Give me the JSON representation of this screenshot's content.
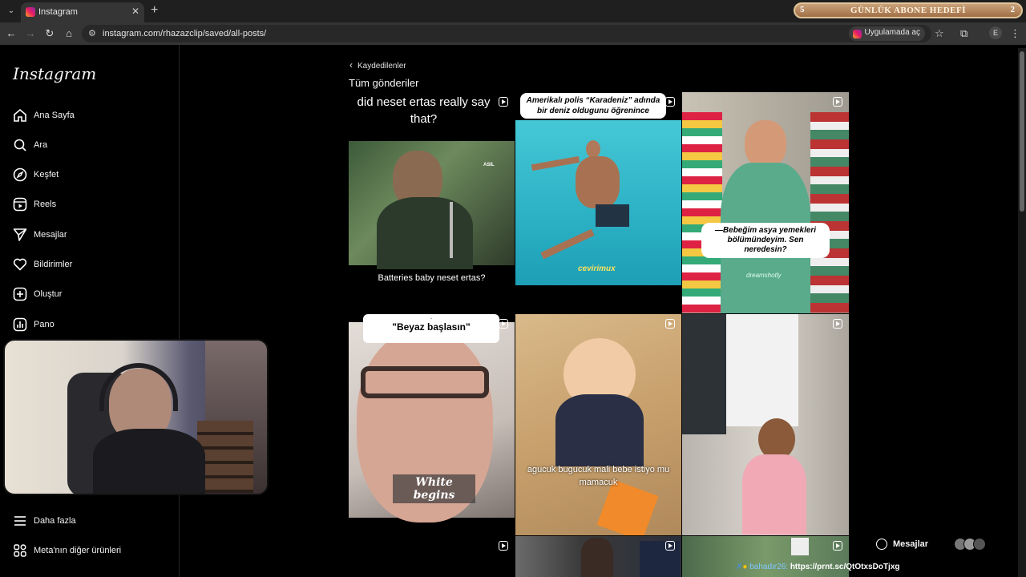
{
  "browser": {
    "tab_title": "Instagram",
    "url": "instagram.com/rhazazclip/saved/all-posts/",
    "open_in_app": "Uygulamada aç",
    "profile_initial": "E"
  },
  "goal_banner": {
    "left": "5",
    "text": "GÜNLÜK ABONE HEDEFİ",
    "right": "2"
  },
  "sidebar": {
    "logo": "Instagram",
    "items": [
      {
        "label": "Ana Sayfa",
        "icon": "home-icon"
      },
      {
        "label": "Ara",
        "icon": "search-icon"
      },
      {
        "label": "Keşfet",
        "icon": "compass-icon"
      },
      {
        "label": "Reels",
        "icon": "reels-icon"
      },
      {
        "label": "Mesajlar",
        "icon": "send-icon"
      },
      {
        "label": "Bildirimler",
        "icon": "heart-icon"
      },
      {
        "label": "Oluştur",
        "icon": "plus-icon"
      },
      {
        "label": "Pano",
        "icon": "dashboard-icon"
      }
    ],
    "bottom": [
      {
        "label": "Daha fazla",
        "icon": "menu-icon"
      },
      {
        "label": "Meta'nın diğer ürünleri",
        "icon": "grid-icon"
      }
    ]
  },
  "main": {
    "breadcrumb": "Kaydedilenler",
    "title": "Tüm gönderiler",
    "posts": [
      {
        "top_text": "did neset ertas really say that?",
        "bottom_text": "Batteries baby neset ertas?",
        "tag": "ASIL"
      },
      {
        "top_text": "Amerikalı polis “Karadeniz” adında bir deniz oldugunu öğrenince",
        "watermark": "cevirimux"
      },
      {
        "bubble": "—Bebeğim asya yemekleri bölümündeyim. Sen neredesin?",
        "watermark": "dreamshotly"
      },
      {
        "top_text": "\"Beyaz başlasın\"",
        "dot": ".",
        "bottom_text": "White begins"
      },
      {
        "caption": "agucuk bugucuk mali bebe istiyo mu mamacuk"
      },
      {},
      {},
      {},
      {}
    ]
  },
  "messages_button": "Mesajlar",
  "chat": {
    "user": "bahadır26:",
    "text": "https://prnt.sc/QtOtxsDoTjxg"
  }
}
